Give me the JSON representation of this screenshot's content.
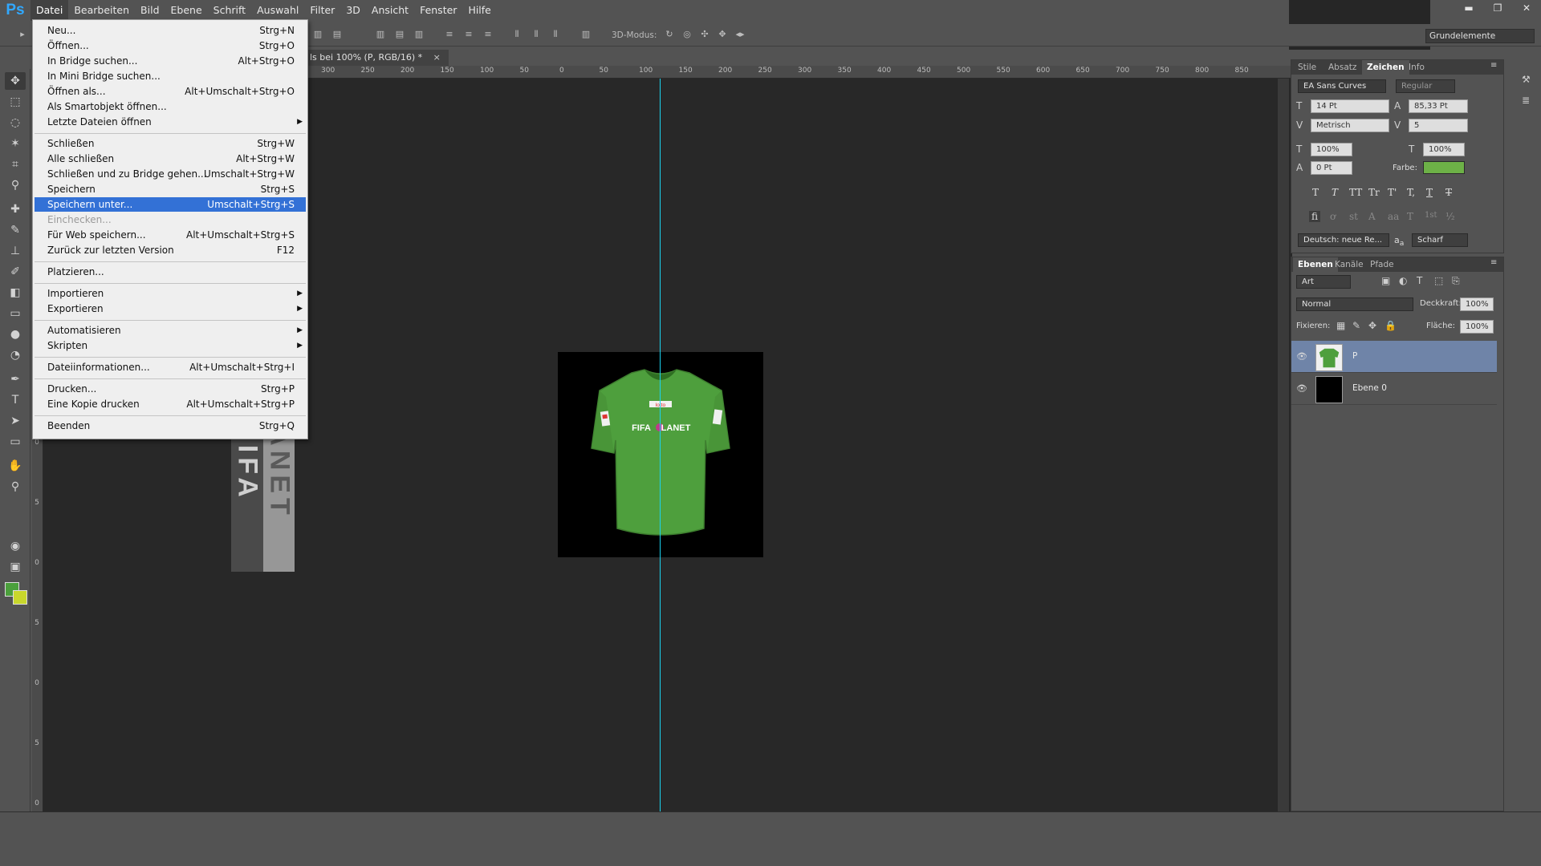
{
  "app": {
    "logo": "Ps"
  },
  "menubar": {
    "items": [
      "Datei",
      "Bearbeiten",
      "Bild",
      "Ebene",
      "Schrift",
      "Auswahl",
      "Filter",
      "3D",
      "Ansicht",
      "Fenster",
      "Hilfe"
    ]
  },
  "window_controls": {
    "minimize": "▬",
    "restore": "❐",
    "close": "✕"
  },
  "options_bar": {
    "mode3d_label": "3D-Modus:",
    "workspace": "Grundelemente"
  },
  "document_tab": {
    "title": "ls bei 100% (P, RGB/16) *",
    "close": "×"
  },
  "ruler": {
    "top_labels": [
      "300",
      "250",
      "200",
      "150",
      "100",
      "50",
      "0",
      "50",
      "100",
      "150",
      "200",
      "250",
      "300",
      "350",
      "400",
      "450",
      "500",
      "550",
      "600",
      "650",
      "700",
      "750",
      "800",
      "850"
    ],
    "left_labels": [
      "0",
      "5",
      "0",
      "5",
      "0",
      "5",
      "0"
    ]
  },
  "file_menu": {
    "items": [
      {
        "label": "Neu...",
        "shortcut": "Strg+N"
      },
      {
        "label": "Öffnen...",
        "shortcut": "Strg+O"
      },
      {
        "label": "In Bridge suchen...",
        "shortcut": "Alt+Strg+O"
      },
      {
        "label": "In Mini Bridge suchen...",
        "shortcut": ""
      },
      {
        "label": "Öffnen als...",
        "shortcut": "Alt+Umschalt+Strg+O"
      },
      {
        "label": "Als Smartobjekt öffnen...",
        "shortcut": ""
      },
      {
        "label": "Letzte Dateien öffnen",
        "shortcut": "",
        "submenu": true
      },
      {
        "label": "Schließen",
        "shortcut": "Strg+W"
      },
      {
        "label": "Alle schließen",
        "shortcut": "Alt+Strg+W"
      },
      {
        "label": "Schließen und zu Bridge gehen...",
        "shortcut": "Umschalt+Strg+W"
      },
      {
        "label": "Speichern",
        "shortcut": "Strg+S"
      },
      {
        "label": "Speichern unter...",
        "shortcut": "Umschalt+Strg+S",
        "highlighted": true
      },
      {
        "label": "Einchecken...",
        "shortcut": "",
        "disabled": true
      },
      {
        "label": "Für Web speichern...",
        "shortcut": "Alt+Umschalt+Strg+S"
      },
      {
        "label": "Zurück zur letzten Version",
        "shortcut": "F12"
      },
      {
        "label": "Platzieren...",
        "shortcut": ""
      },
      {
        "label": "Importieren",
        "shortcut": "",
        "submenu": true
      },
      {
        "label": "Exportieren",
        "shortcut": "",
        "submenu": true
      },
      {
        "label": "Automatisieren",
        "shortcut": "",
        "submenu": true
      },
      {
        "label": "Skripten",
        "shortcut": "",
        "submenu": true
      },
      {
        "label": "Dateiinformationen...",
        "shortcut": "Alt+Umschalt+Strg+I"
      },
      {
        "label": "Drucken...",
        "shortcut": "Strg+P"
      },
      {
        "label": "Eine Kopie drucken",
        "shortcut": "Alt+Umschalt+Strg+P"
      },
      {
        "label": "Beenden",
        "shortcut": "Strg+Q"
      }
    ]
  },
  "watermark": {
    "left_text": "EWOXFIFA",
    "right_text": "FIFAPLANET"
  },
  "shirt": {
    "brand": "FIFA",
    "brand2": "LANET",
    "sponsor": "lotto"
  },
  "character_panel": {
    "tabs": [
      "Stile",
      "Absatz",
      "Zeichen",
      "Info"
    ],
    "font_family": "EA Sans Curves",
    "font_style": "Regular",
    "font_size": "14 Pt",
    "leading": "85,33 Pt",
    "kerning": "Metrisch",
    "tracking": "5",
    "vertical_scale": "100%",
    "horizontal_scale": "100%",
    "baseline_shift": "0 Pt",
    "color_label": "Farbe:",
    "language": "Deutsch: neue Re...",
    "antialias_glyph": "a",
    "antialias_sub": "a",
    "antialias": "Scharf",
    "style_buttons": [
      "T",
      "T",
      "TT",
      "Tr",
      "T'",
      "T,",
      "T",
      "T"
    ],
    "opentype_buttons": [
      "fi",
      "ơ",
      "st",
      "A",
      "aa",
      "T",
      "1st",
      "½"
    ]
  },
  "layers_panel": {
    "tabs": [
      "Ebenen",
      "Kanäle",
      "Pfade"
    ],
    "filter": "Art",
    "blend_mode": "Normal",
    "opacity_label": "Deckkraft:",
    "opacity": "100%",
    "lock_label": "Fixieren:",
    "fill_label": "Fläche:",
    "fill": "100%",
    "layers": [
      {
        "name": "P",
        "selected": true
      },
      {
        "name": "Ebene 0",
        "selected": false
      }
    ]
  },
  "colors": {
    "foreground": "#4ba03c",
    "background": "#c8d72c",
    "highlight": "#3371d6",
    "guide": "#1ad3f0",
    "shirt": "#4e9f3d"
  }
}
